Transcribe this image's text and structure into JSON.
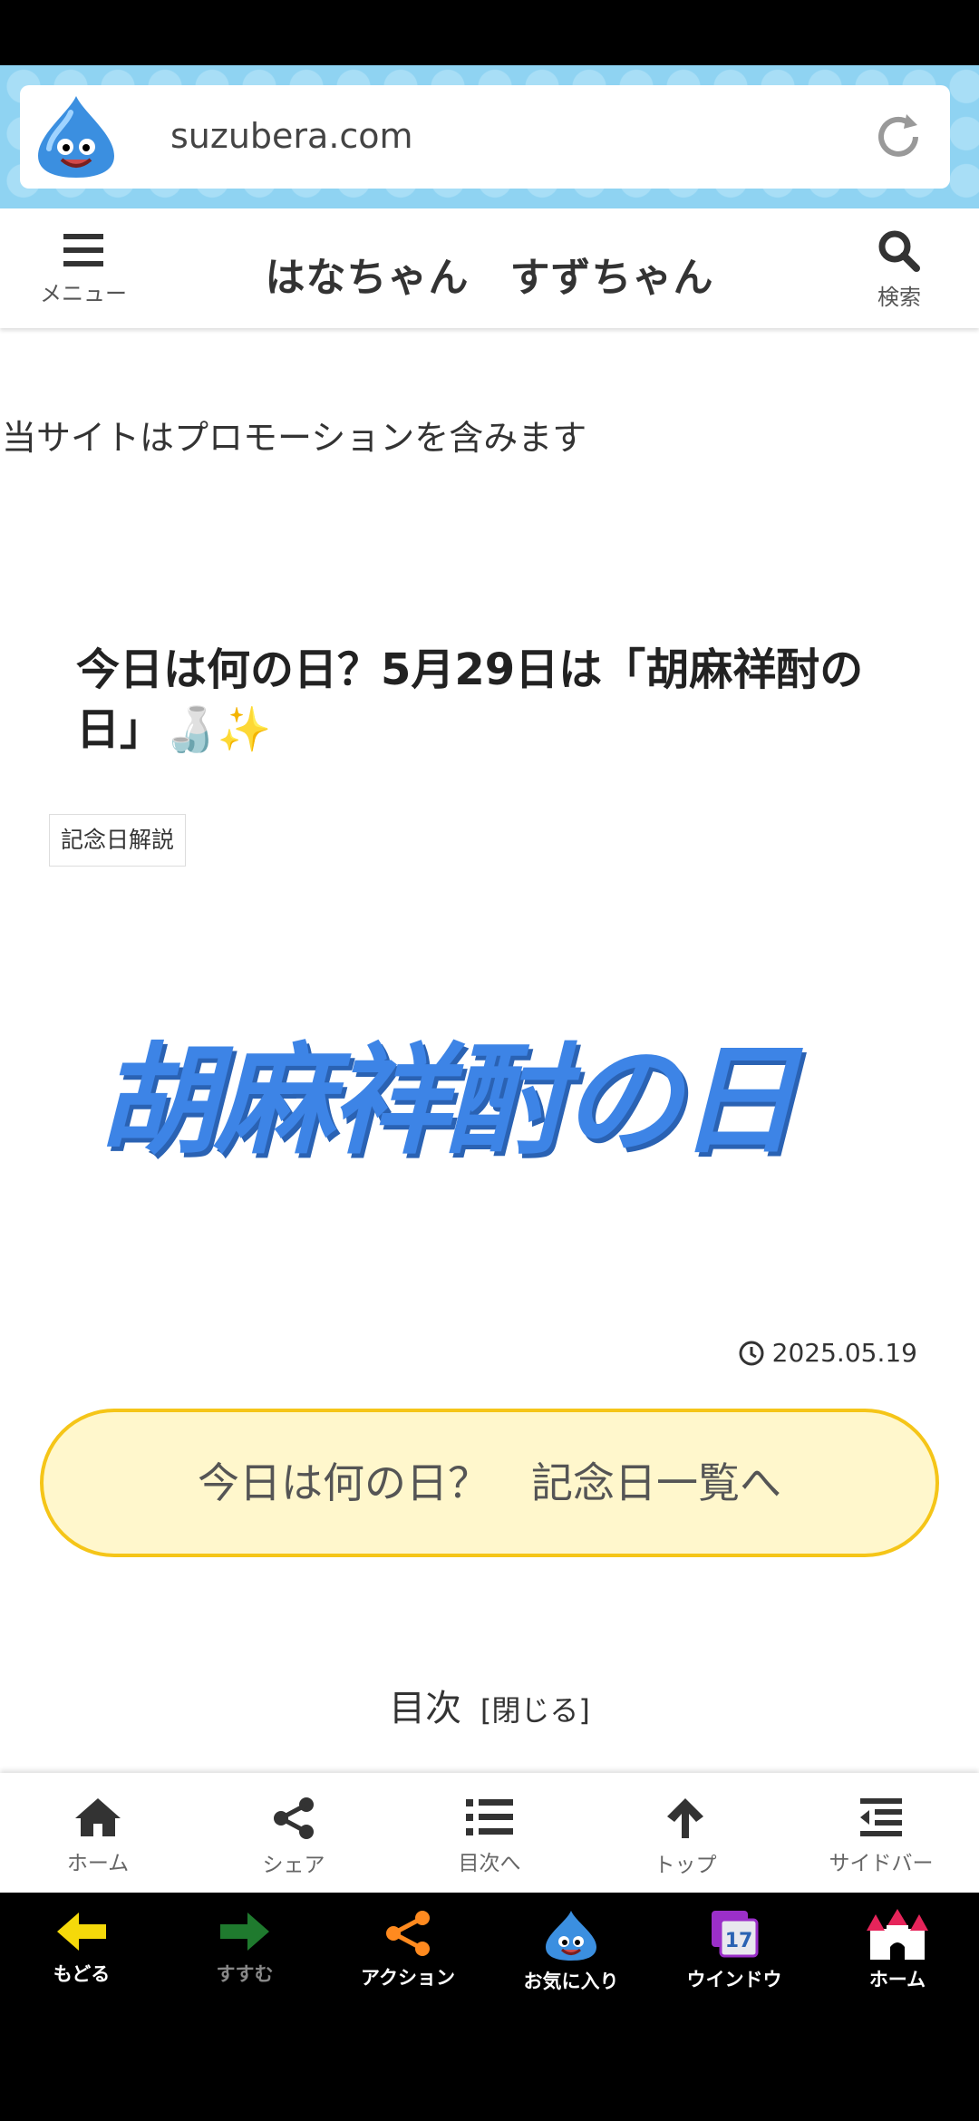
{
  "browser": {
    "url": "suzubera.com"
  },
  "header": {
    "menu_label": "メニュー",
    "site_title": "はなちゃん　すずちゃん",
    "search_label": "検索"
  },
  "notice": "当サイトはプロモーションを含みます",
  "post": {
    "title": "今日は何の日？5月29日は「胡麻祥酎の日」🍶✨",
    "category": "記念日解説",
    "eyecatch_text": "胡麻祥酎の日",
    "date": "2025.05.19",
    "cta_label": "今日は何の日？　記念日一覧へ",
    "toc_title": "目次",
    "toc_toggle": "[閉じる]"
  },
  "bottom_nav": [
    {
      "label": "ホーム",
      "icon": "home-icon"
    },
    {
      "label": "シェア",
      "icon": "share-icon"
    },
    {
      "label": "目次へ",
      "icon": "list-icon"
    },
    {
      "label": "トップ",
      "icon": "arrow-up-icon"
    },
    {
      "label": "サイドバー",
      "icon": "sidebar-icon"
    }
  ],
  "browser_bar": [
    {
      "label": "もどる",
      "icon": "back-arrow-icon"
    },
    {
      "label": "すすむ",
      "icon": "forward-arrow-icon"
    },
    {
      "label": "アクション",
      "icon": "share-icon"
    },
    {
      "label": "お気に入り",
      "icon": "slime-icon"
    },
    {
      "label": "ウインドウ",
      "icon": "window-icon",
      "badge": "17"
    },
    {
      "label": "ホーム",
      "icon": "castle-icon"
    }
  ],
  "colors": {
    "accent_blue": "#3d84e6",
    "cta_fill": "#fff7cc",
    "cta_border": "#f5c518",
    "url_bg": "#8fd3f2"
  }
}
